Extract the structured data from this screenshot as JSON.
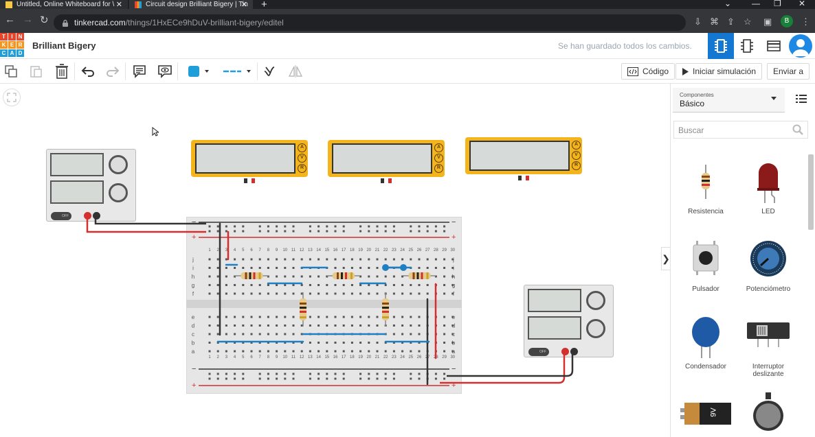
{
  "browser": {
    "tabs": [
      {
        "title": "Untitled, Online Whiteboard for \\",
        "active": false,
        "favicon_color": "#f7c948"
      },
      {
        "title": "Circuit design Brilliant Bigery | Tin",
        "active": true,
        "favicon_color": "#f9a825"
      }
    ],
    "new_tab": "+",
    "window_controls": [
      "⌄",
      "—",
      "❐",
      "✕"
    ],
    "nav": [
      "←",
      "→",
      "↻"
    ],
    "url_host": "tinkercad.com",
    "url_path": "/things/1HxECe9hDuV-brilliant-bigery/editel",
    "profile_letter": "B"
  },
  "app": {
    "logo_letters": [
      "T",
      "I",
      "N",
      "K",
      "E",
      "R",
      "C",
      "A",
      "D"
    ],
    "logo_colors": [
      "#e8452c",
      "#e8452c",
      "#e8452c",
      "#f7941d",
      "#f7941d",
      "#f7941d",
      "#1f9ed9",
      "#1f9ed9",
      "#1f9ed9"
    ],
    "project_title": "Brilliant Bigery",
    "save_status": "Se han guardado todos los cambios.",
    "accent": "#1477d1"
  },
  "toolbar": {
    "tools": [
      "copy-icon",
      "paste-icon",
      "delete-icon",
      "undo-icon",
      "redo-icon",
      "note-icon",
      "view-icon",
      "color-swatch",
      "line-style",
      "wire-tool-icon",
      "flip-icon"
    ],
    "wire_color": "#1f9ed9",
    "code_label": "Código",
    "simulate_label": "Iniciar simulación",
    "send_label": "Enviar a"
  },
  "panel": {
    "select_caption": "Componentes",
    "select_value": "Básico",
    "search_placeholder": "Buscar",
    "components": [
      {
        "label": "Resistencia",
        "icon": "resistor-icon"
      },
      {
        "label": "LED",
        "icon": "led-icon"
      },
      {
        "label": "Pulsador",
        "icon": "pushbutton-icon"
      },
      {
        "label": "Potenciómetro",
        "icon": "potentiometer-icon"
      },
      {
        "label": "Condensador",
        "icon": "capacitor-icon"
      },
      {
        "label": "Interruptor deslizante",
        "icon": "slide-switch-icon"
      },
      {
        "label": "",
        "icon": "battery-9v-icon"
      },
      {
        "label": "",
        "icon": "coin-battery-icon"
      }
    ],
    "battery_text": "9V"
  },
  "canvas": {
    "multimeter_buttons": [
      "A",
      "V",
      "R"
    ],
    "psu_switch_label": "OFF",
    "breadboard_col_numbers": [
      "1",
      "2",
      "3",
      "4",
      "5",
      "6",
      "7",
      "8",
      "9",
      "10",
      "11",
      "12",
      "13",
      "14",
      "15",
      "16",
      "17",
      "18",
      "19",
      "20",
      "21",
      "22",
      "23",
      "24",
      "25",
      "26",
      "27",
      "28",
      "29",
      "30"
    ],
    "breadboard_rows_top": [
      "j",
      "i",
      "h",
      "g",
      "f"
    ],
    "breadboard_rows_bottom": [
      "e",
      "d",
      "c",
      "b",
      "a"
    ],
    "rail_minus": "−",
    "rail_plus": "+"
  }
}
